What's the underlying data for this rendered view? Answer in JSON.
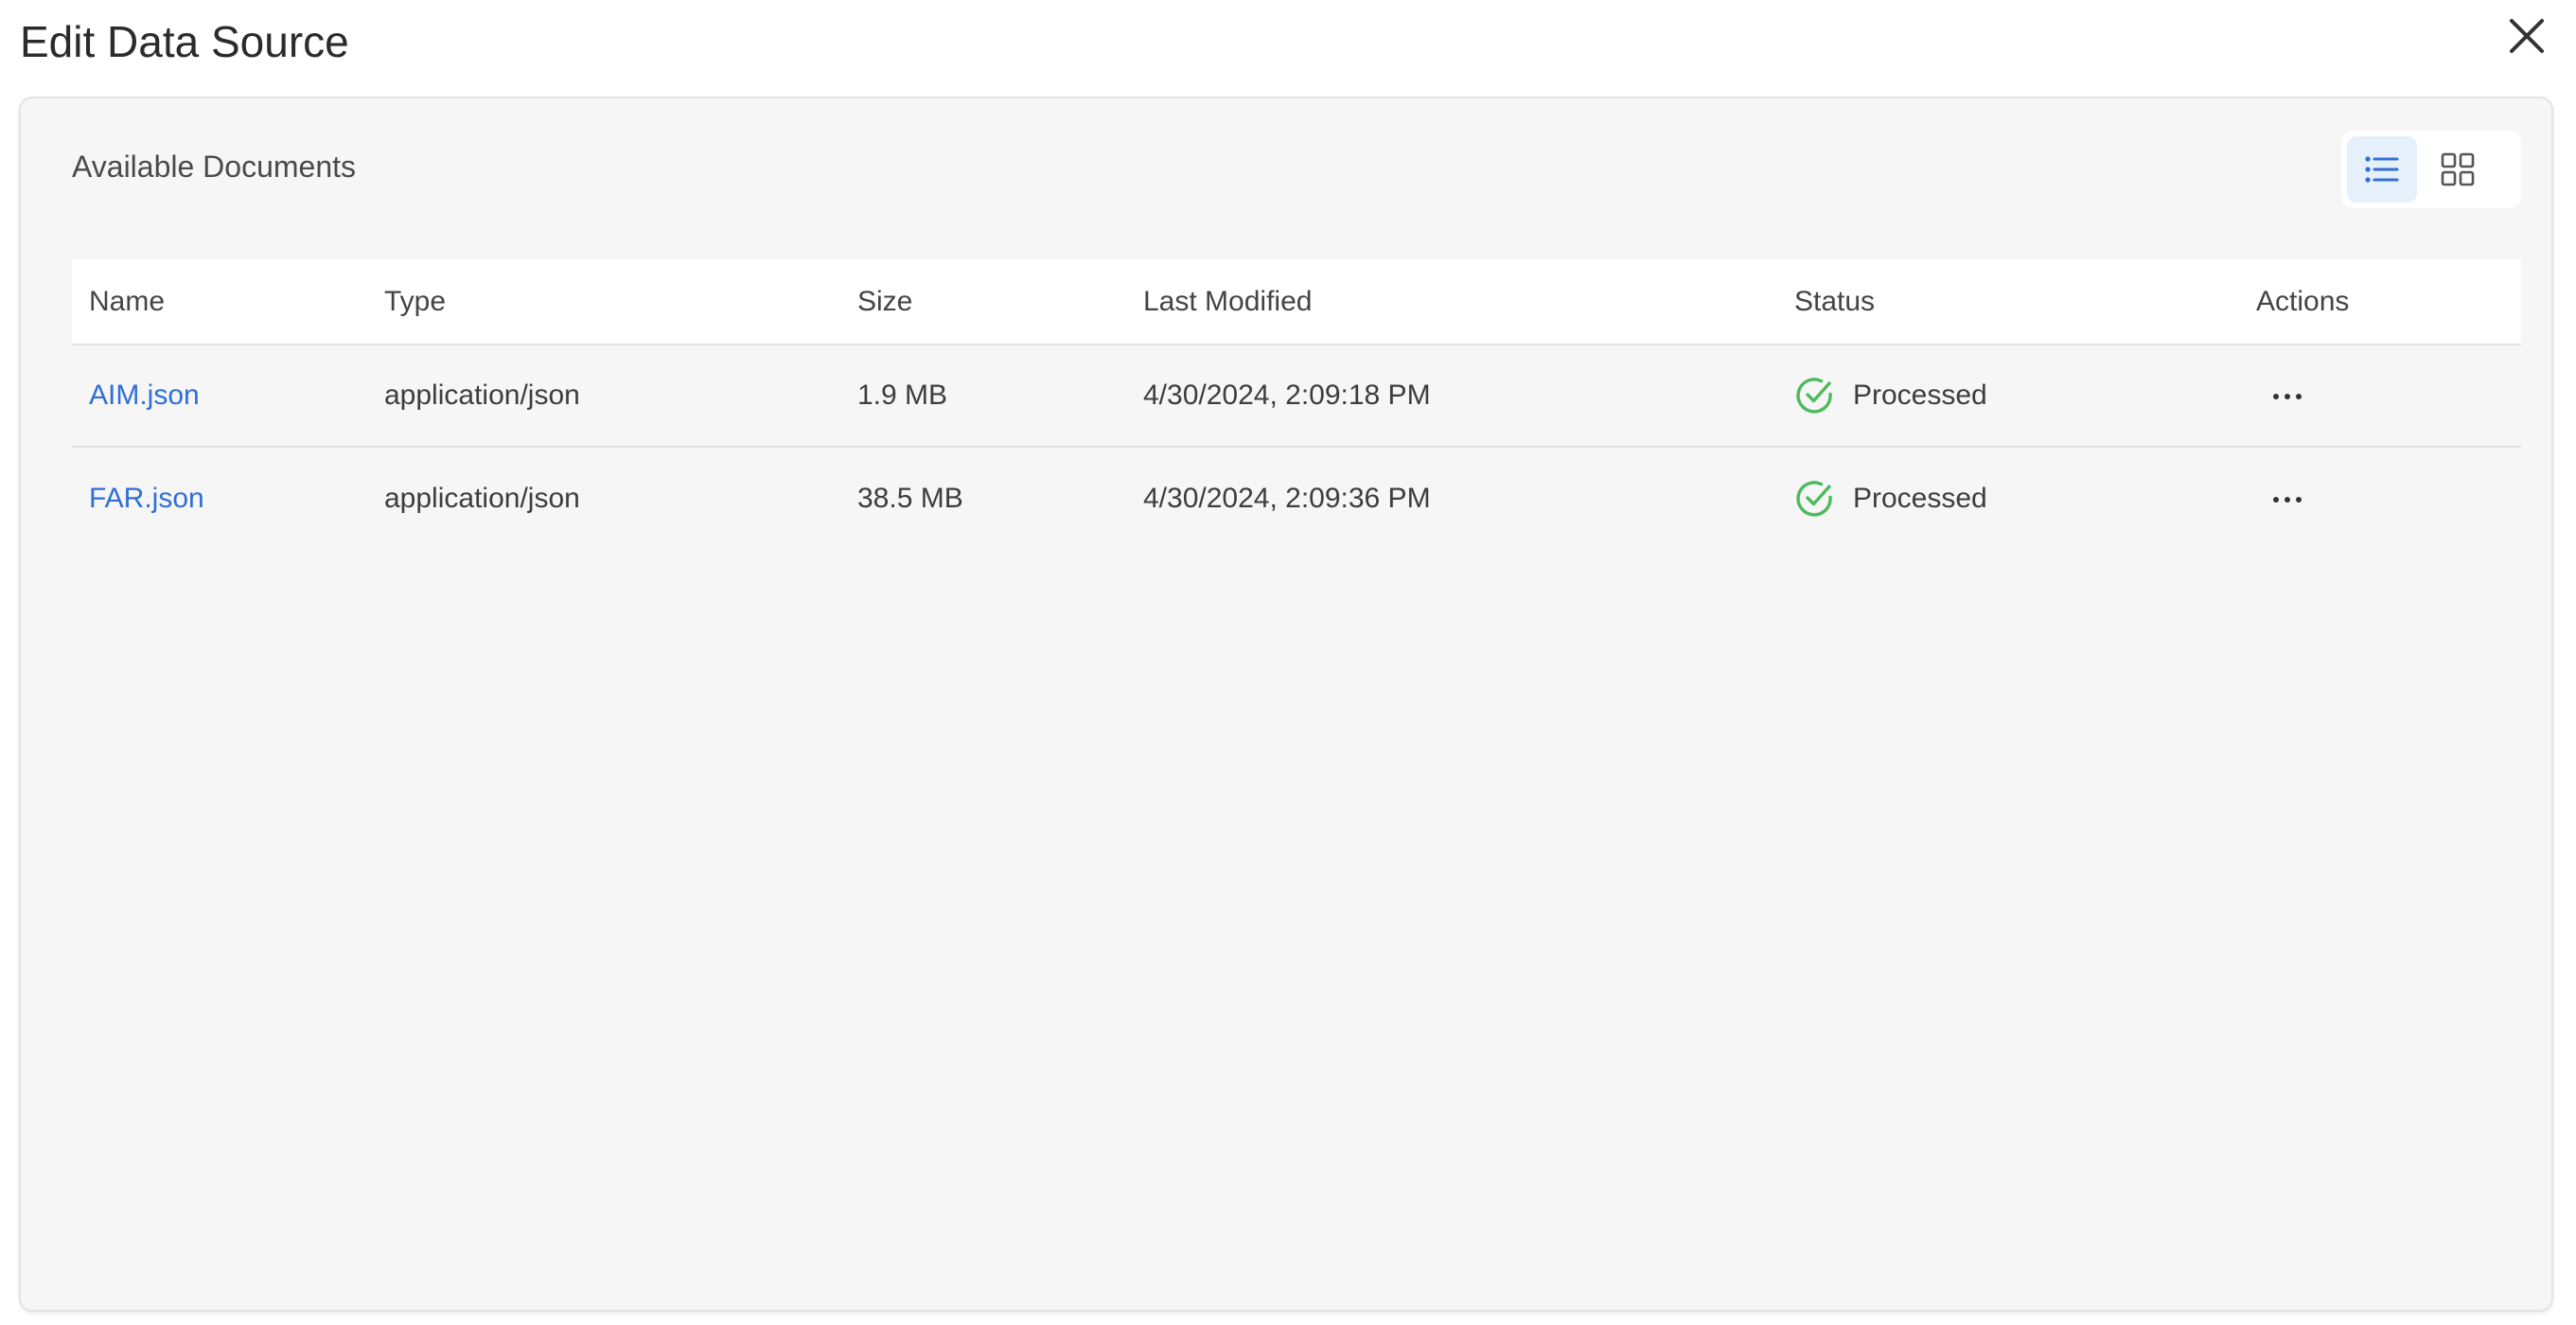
{
  "dialog": {
    "title": "Edit Data Source"
  },
  "panel": {
    "title": "Available Documents",
    "view_toggle": {
      "active": "list",
      "icons": [
        "list-view-icon",
        "grid-view-icon"
      ]
    }
  },
  "table": {
    "columns": [
      "Name",
      "Type",
      "Size",
      "Last Modified",
      "Status",
      "Actions"
    ],
    "rows": [
      {
        "name": "AIM.json",
        "type": "application/json",
        "size": "1.9 MB",
        "modified": "4/30/2024, 2:09:18 PM",
        "status": "Processed"
      },
      {
        "name": "FAR.json",
        "type": "application/json",
        "size": "38.5 MB",
        "modified": "4/30/2024, 2:09:36 PM",
        "status": "Processed"
      }
    ]
  },
  "colors": {
    "link": "#2f6fd6",
    "status_ok": "#4cbb5a",
    "toggle_active_bg": "#e6f0fb",
    "toggle_active_icon": "#2f6fd6",
    "panel_bg": "#f6f6f6"
  }
}
